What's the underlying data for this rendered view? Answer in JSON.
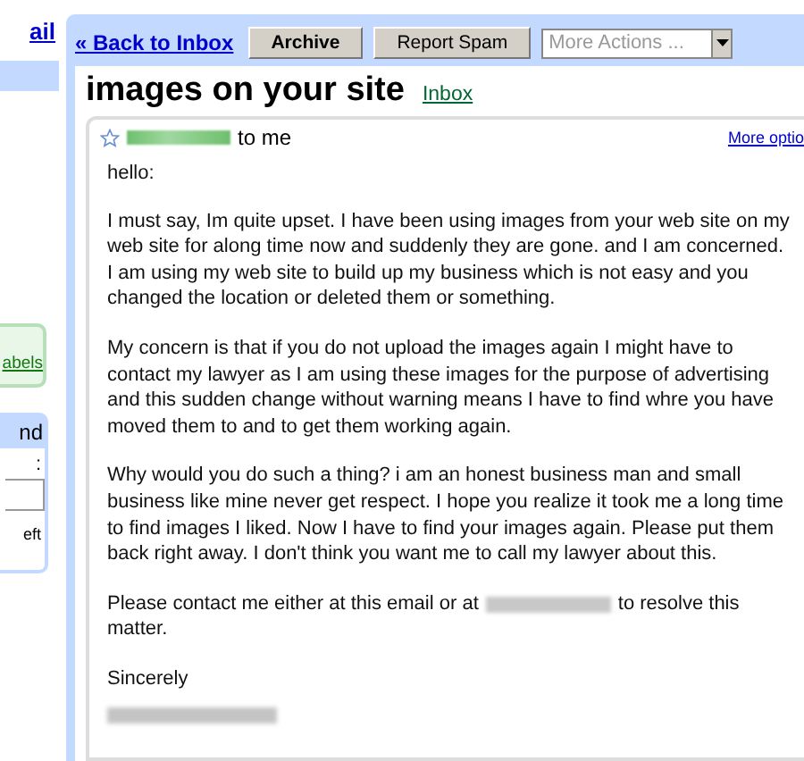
{
  "sidebar": {
    "link": "ail",
    "labels_link": "abels",
    "search_box": {
      "title": "nd",
      "label": ":",
      "note": "eft"
    }
  },
  "toolbar": {
    "back_link": "« Back to Inbox",
    "buttons": [
      "Archive",
      "Report Spam"
    ],
    "more_actions": {
      "placeholder": "More Actions ..."
    }
  },
  "message": {
    "subject": "images on your site",
    "label": "Inbox",
    "starred": false,
    "recipient": "to me",
    "options_link": "More optio",
    "greeting": "hello:",
    "paragraphs": [
      "I must say, Im quite upset. I have been using images from your web site on my web site for along time now and suddenly they are gone. and I am concerned. I am using my web site to build up my business which is not easy and you changed the location or deleted them or something.",
      "My concern is that if you do not upload the images again I might have to contact my lawyer as I am using these images for the purpose of advertising and this sudden change without warning means I have to find whre you have moved them to and to get them working again.",
      "Why would you do such a thing? i am an honest business man and small business like mine never get respect. I hope you realize it took me a long time to find images I liked. Now I have to find your images again. Please put them back right away. I don't think you want me to call my lawyer about this."
    ],
    "contact": {
      "before": "Please contact me either at this email or at",
      "after": "to resolve this",
      "continued": "matter."
    },
    "closing": "Sincerely"
  }
}
